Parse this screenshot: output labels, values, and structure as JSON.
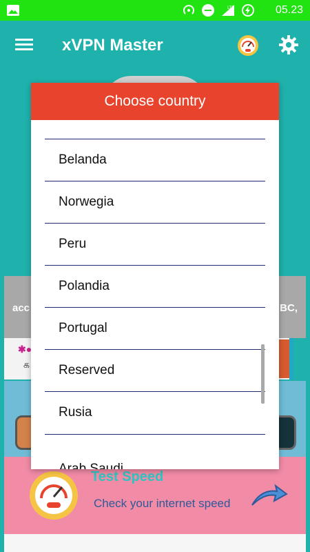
{
  "status": {
    "time": "05.23"
  },
  "appbar": {
    "title": "xVPN Master"
  },
  "background": {
    "banner_left": "acc",
    "banner_right": "BC,",
    "ad_text": "க"
  },
  "dialog": {
    "title": "Choose country",
    "items": [
      "Belanda",
      "Norwegia",
      "Peru",
      "Polandia",
      "Portugal",
      "Reserved",
      "Rusia",
      "Arab Saudi"
    ]
  },
  "test_speed": {
    "title": "Test Speed",
    "subtitle": "Check your internet speed"
  },
  "colors": {
    "statusbar": "#22e312",
    "appbar": "#1fb2ad",
    "dialog_header": "#e8432c",
    "divider": "#1d2a6e",
    "test_card": "#f28ba6"
  },
  "icons": {
    "status_left": "image-icon",
    "menu": "menu-icon",
    "speed": "speedometer-icon",
    "settings": "gear-icon",
    "arrow": "arrow-forward-icon"
  }
}
